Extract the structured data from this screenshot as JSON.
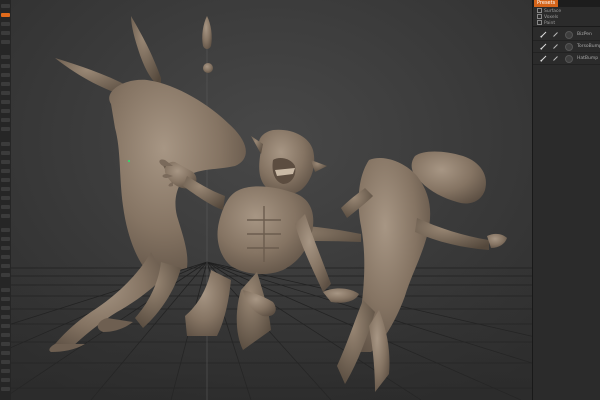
{
  "panel": {
    "tab_label": "Presets",
    "filters": [
      "Surface",
      "Voxels",
      "Paint"
    ],
    "layers": [
      {
        "name": "BizPen"
      },
      {
        "name": "TorsoBump"
      },
      {
        "name": "HatBump"
      }
    ]
  },
  "colors": {
    "accent": "#d4641a",
    "viewport_bg": "#3a3a3a",
    "sculpt_clay": "#8b7a6a",
    "panel_bg": "#2b2b2b"
  }
}
